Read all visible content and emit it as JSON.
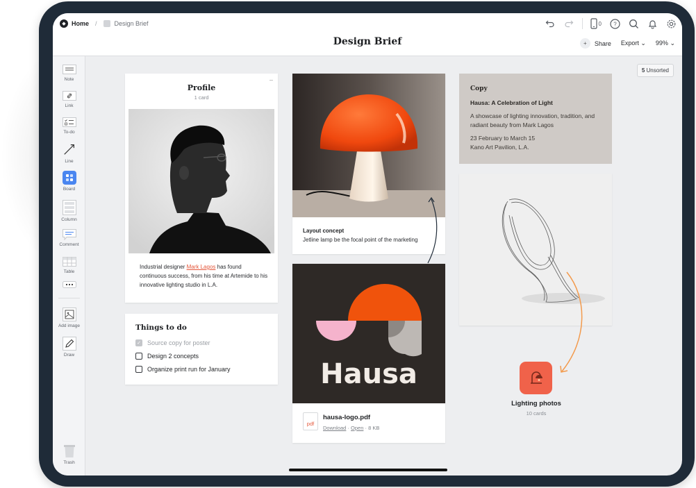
{
  "breadcrumb": {
    "home": "Home",
    "current": "Design Brief"
  },
  "header": {
    "title": "Design Brief",
    "share_label": "Share",
    "export_label": "Export",
    "zoom": "99%",
    "device_count": "0"
  },
  "unsorted": {
    "count": "5",
    "label": "Unsorted"
  },
  "sidebar": {
    "tools": [
      {
        "label": "Note",
        "icon": "note-icon"
      },
      {
        "label": "Link",
        "icon": "link-icon"
      },
      {
        "label": "To-do",
        "icon": "todo-icon"
      },
      {
        "label": "Line",
        "icon": "line-icon"
      },
      {
        "label": "Board",
        "icon": "board-icon"
      },
      {
        "label": "Column",
        "icon": "column-icon"
      },
      {
        "label": "Comment",
        "icon": "comment-icon"
      },
      {
        "label": "Table",
        "icon": "table-icon"
      },
      {
        "label": "Add image",
        "icon": "add-image-icon"
      },
      {
        "label": "Draw",
        "icon": "draw-icon"
      },
      {
        "label": "Trash",
        "icon": "trash-icon"
      }
    ]
  },
  "profile": {
    "title": "Profile",
    "count": "1 card",
    "caption_pre": "Industrial designer ",
    "caption_link": "Mark Lagos",
    "caption_post": " has found continuous success, from his time at Artemide to his innovative lighting studio in L.A."
  },
  "todo": {
    "title": "Things to do",
    "items": [
      {
        "label": "Source copy for poster",
        "done": true
      },
      {
        "label": "Design 2 concepts",
        "done": false
      },
      {
        "label": "Organize print run for January",
        "done": false
      }
    ]
  },
  "layout_concept": {
    "title": "Layout concept",
    "desc": "Jetline lamp be the focal point of the marketing"
  },
  "logo_card": {
    "logo_text": "Hausa",
    "file_ext": "pdf",
    "file_name": "hausa-logo.pdf",
    "download": "Download",
    "open": "Open",
    "size": "8 KB"
  },
  "copy": {
    "label": "Copy",
    "heading": "Hausa: A Celebration of Light",
    "para1": "A showcase of lighting innovation, tradition, and radiant beauty from Mark Lagos",
    "para2_line1": "23 February to March 15",
    "para2_line2": "Kano Art Pavilion, L.A."
  },
  "lighting_board": {
    "name": "Lighting photos",
    "count": "10 cards"
  },
  "colors": {
    "accent": "#f0624a",
    "frame": "#1f2b38",
    "canvas": "#edeef0",
    "board_blue": "#4a86f0"
  }
}
